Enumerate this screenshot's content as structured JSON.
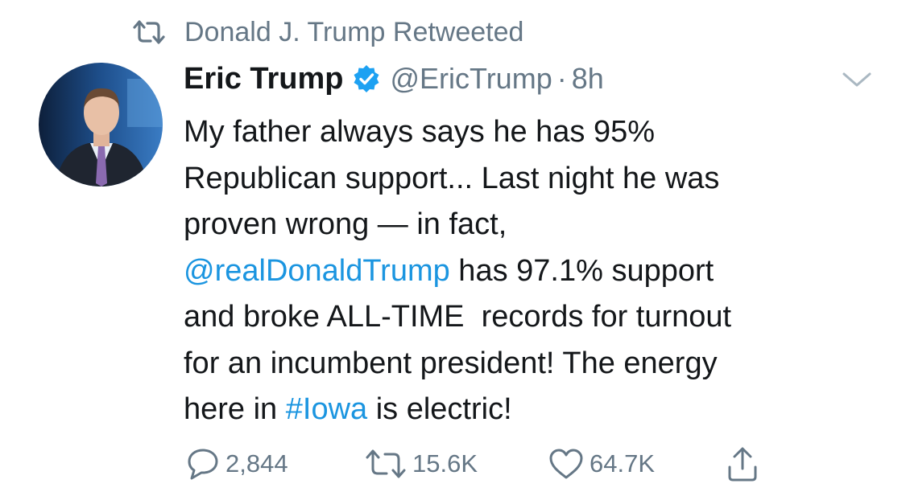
{
  "retweet_context": {
    "icon": "retweet-icon",
    "text": "Donald J. Trump Retweeted"
  },
  "author": {
    "name": "Eric Trump",
    "verified_icon": "verified-badge-icon",
    "handle": "@EricTrump",
    "separator": "·",
    "time": "8h"
  },
  "tweet": {
    "lines": [
      [
        {
          "text": "My father always says he has 95%"
        }
      ],
      [
        {
          "text": "Republican support... Last night he was"
        }
      ],
      [
        {
          "text": "proven wrong — in fact,"
        }
      ],
      [
        {
          "text": "@realDonaldTrump",
          "link": true
        },
        {
          "text": " has 97.1% support"
        }
      ],
      [
        {
          "text": "and broke ALL-TIME  records for turnout"
        }
      ],
      [
        {
          "text": "for an incumbent president! The energy"
        }
      ],
      [
        {
          "text": "here in "
        },
        {
          "text": "#Iowa",
          "link": true
        },
        {
          "text": " is electric!"
        }
      ]
    ]
  },
  "actions": {
    "reply_count": "2,844",
    "retweet_count": "15.6K",
    "like_count": "64.7K"
  },
  "colors": {
    "text": "#14171a",
    "secondary": "#657786",
    "link": "#1b95e0",
    "verified": "#1da1f2"
  }
}
